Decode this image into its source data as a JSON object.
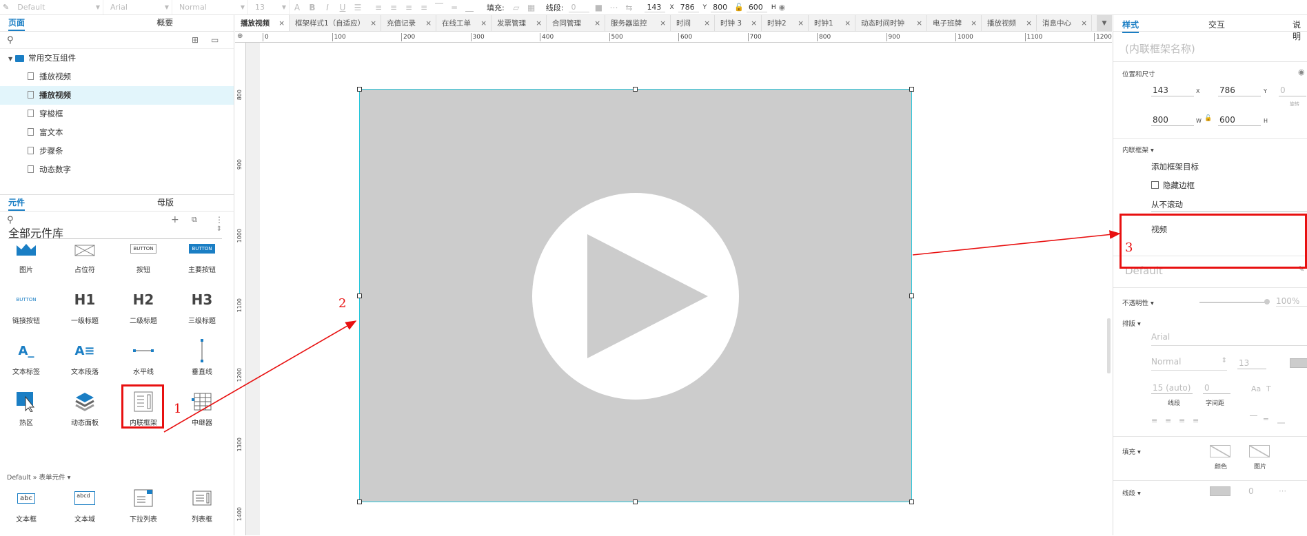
{
  "toolbar": {
    "style_select": "Default",
    "font_select": "Arial",
    "weight_select": "Normal",
    "size_select": "13",
    "fill_label": "填充:",
    "stroke_label": "线段:",
    "stroke_value": "0",
    "x": "143",
    "x_label": "X",
    "y": "786",
    "y_label": "Y",
    "w": "800",
    "w_label": "W",
    "h": "600",
    "h_label": "H"
  },
  "pages_panel": {
    "tab_pages": "页面",
    "tab_outline": "概要",
    "folder": "常用交互组件",
    "items": [
      "播放视频",
      "播放视频",
      "穿梭框",
      "富文本",
      "步骤条",
      "动态数字"
    ],
    "selected_index": 1
  },
  "widgets_panel": {
    "tab_widgets": "元件",
    "tab_masters": "母版",
    "library_name": "全部元件库",
    "widgets": [
      {
        "label": "图片",
        "icon": "image-icon"
      },
      {
        "label": "占位符",
        "icon": "placeholder-icon"
      },
      {
        "label": "按钮",
        "icon": "button-icon",
        "glyph": "BUTTON"
      },
      {
        "label": "主要按钮",
        "icon": "primary-button-icon",
        "glyph": "BUTTON"
      },
      {
        "label": "链接按钮",
        "icon": "link-button-icon",
        "glyph": "BUTTON"
      },
      {
        "label": "一级标题",
        "icon": "h1-icon",
        "glyph": "H1"
      },
      {
        "label": "二级标题",
        "icon": "h2-icon",
        "glyph": "H2"
      },
      {
        "label": "三级标题",
        "icon": "h3-icon",
        "glyph": "H3"
      },
      {
        "label": "文本标签",
        "icon": "text-label-icon",
        "glyph": "A_"
      },
      {
        "label": "文本段落",
        "icon": "paragraph-icon",
        "glyph": "A≡"
      },
      {
        "label": "水平线",
        "icon": "horizontal-line-icon"
      },
      {
        "label": "垂直线",
        "icon": "vertical-line-icon"
      },
      {
        "label": "热区",
        "icon": "hotspot-icon"
      },
      {
        "label": "动态面板",
        "icon": "dynamic-panel-icon"
      },
      {
        "label": "内联框架",
        "icon": "inline-frame-icon"
      },
      {
        "label": "中继器",
        "icon": "repeater-icon"
      }
    ],
    "form_section": "Default » 表单元件 ▾",
    "form_widgets": [
      {
        "label": "文本框",
        "icon": "textbox-icon",
        "glyph": "abc"
      },
      {
        "label": "文本域",
        "icon": "textarea-icon",
        "glyph": "abcd"
      },
      {
        "label": "下拉列表",
        "icon": "dropdown-icon"
      },
      {
        "label": "列表框",
        "icon": "listbox-icon"
      }
    ]
  },
  "doc_tabs": [
    "播放视频",
    "框架样式1（自适应）",
    "充值记录",
    "在线工单",
    "发票管理",
    "合同管理",
    "服务器监控",
    "时间",
    "时钟 3",
    "时钟2",
    "时钟1",
    "动态时间时钟",
    "电子班牌",
    "播放视频",
    "消息中心"
  ],
  "active_doc_tab": 0,
  "ruler_top": [
    "0",
    "100",
    "200",
    "300",
    "400",
    "500",
    "600",
    "700",
    "800",
    "900",
    "1000",
    "1100",
    "1200"
  ],
  "ruler_left": [
    "800",
    "900",
    "1000",
    "1100",
    "1200",
    "1300",
    "1400"
  ],
  "right_panel": {
    "tab_style": "样式",
    "tab_interact": "交互",
    "tab_notes": "说明",
    "name_placeholder": "(内联框架名称)",
    "pos_size_label": "位置和尺寸",
    "x": "143",
    "x_label": "X",
    "y": "786",
    "y_label": "Y",
    "rotation": "0",
    "rotation_label": "旋转",
    "w": "800",
    "w_label": "W",
    "h": "600",
    "h_label": "H",
    "inline_frame_label": "内联框架 ▾",
    "add_target": "添加框架目标",
    "hide_border": "隐藏边框",
    "scroll_option": "从不滚动",
    "frame_target": "视频",
    "style_name": "Default",
    "opacity_label": "不透明性 ▾",
    "opacity_value": "100%",
    "typography_label": "排版 ▾",
    "font": "Arial",
    "weight": "Normal",
    "size": "13",
    "line_height": "15 (auto)",
    "letter_spacing": "0",
    "line_height_label": "线段",
    "letter_spacing_label": "字间距",
    "fill_label": "填充 ▾",
    "fill_color_label": "颜色",
    "fill_image_label": "图片",
    "stroke_label": "线段 ▾",
    "stroke_value": "0"
  },
  "annotations": [
    "1",
    "2",
    "3"
  ],
  "colors": {
    "accent": "#1a7ec4",
    "selection": "#26c6da",
    "annotation": "#e81010",
    "frame_fill": "#cccccc"
  }
}
